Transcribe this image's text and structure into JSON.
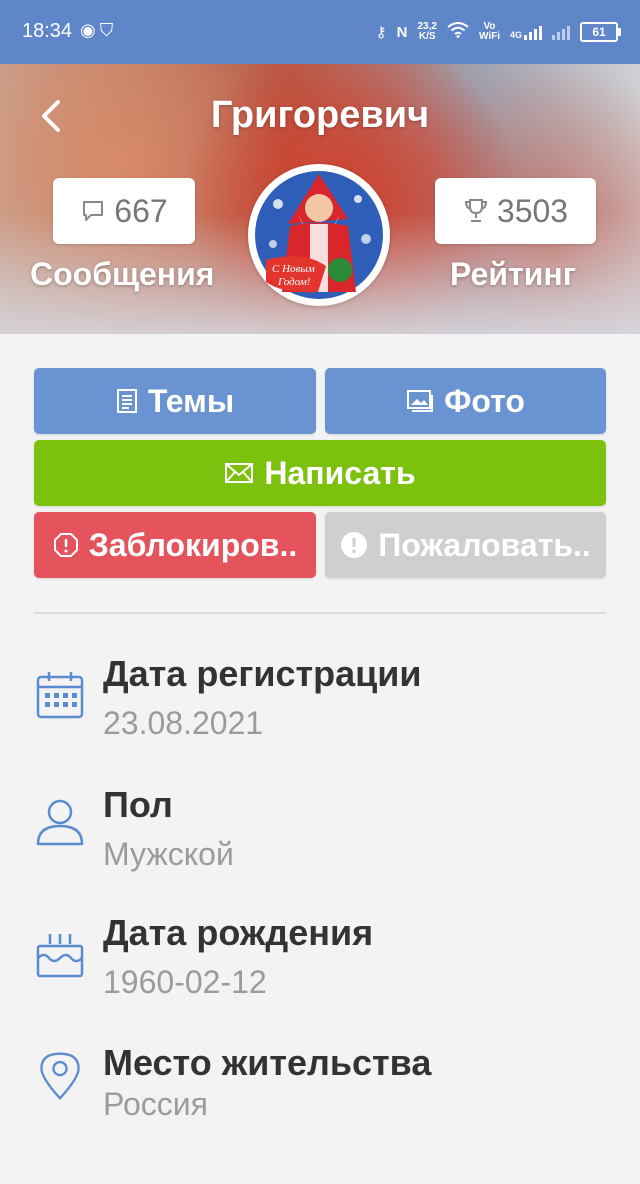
{
  "status_bar": {
    "time": "18:34",
    "net_speed_value": "23,2",
    "net_speed_unit": "K/S",
    "vowifi_top": "Vo",
    "vowifi_bottom": "WiFi",
    "network": "4G",
    "battery": "61"
  },
  "header": {
    "name": "Григоревич",
    "messages_count": "667",
    "messages_label": "Сообщения",
    "rating_value": "3503",
    "rating_label": "Рейтинг"
  },
  "avatar": {
    "banner_line1": "С Новым",
    "banner_line2": "Годом!"
  },
  "actions": {
    "topics": "Темы",
    "photo": "Фото",
    "write": "Написать",
    "block": "Заблокиров..",
    "report": "Пожаловать.."
  },
  "info": [
    {
      "title": "Дата регистрации",
      "value": "23.08.2021",
      "icon": "calendar-icon"
    },
    {
      "title": "Пол",
      "value": "Мужской",
      "icon": "user-icon"
    },
    {
      "title": "Дата рождения",
      "value": "1960-02-12",
      "icon": "birthday-cake-icon"
    },
    {
      "title": "Место жительства",
      "value": "Россия",
      "icon": "location-pin-icon"
    }
  ],
  "colors": {
    "status_bar": "#5f86c8",
    "primary_button": "#6a93d1",
    "write_button": "#7cc10e",
    "block_button": "#e5535c",
    "report_button": "#cfcfcf",
    "icon_accent": "#5b8ccf"
  }
}
